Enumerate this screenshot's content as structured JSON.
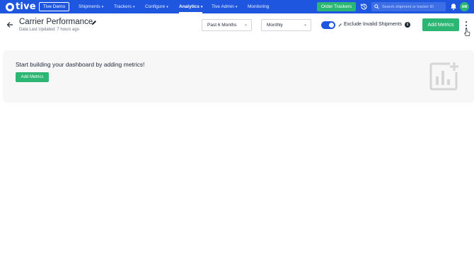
{
  "brand": {
    "name": "tive"
  },
  "topbar": {
    "workspace": "Tive Demo",
    "nav": [
      {
        "label": "Shipments",
        "has_menu": true
      },
      {
        "label": "Trackers",
        "has_menu": true
      },
      {
        "label": "Configure",
        "has_menu": true
      },
      {
        "label": "Analytics",
        "has_menu": true,
        "active": true
      },
      {
        "label": "Tive Admin",
        "has_menu": true
      },
      {
        "label": "Monitoring",
        "has_menu": false
      }
    ],
    "order_button": "Order Trackers",
    "search_placeholder": "Search shipment or tracker ID",
    "avatar_initials": "AM"
  },
  "header": {
    "title": "Carrier Performance",
    "updated": "Data Last Updated: 7 hours ago",
    "range_select": "Past 6 Months",
    "period_select": "Monthly",
    "exclude_toggle_on": true,
    "exclude_label": "Exclude Invalid Shipments",
    "add_button": "Add Metrics"
  },
  "empty_state": {
    "message": "Start building your dashboard by adding metrics!",
    "button": "Add Metrics"
  },
  "colors": {
    "primary": "#1e56e0",
    "accent_green": "#2bb673",
    "card_bg": "#f7f7f7"
  },
  "icons": [
    "history-icon",
    "search-icon",
    "bell-icon",
    "back-arrow-icon",
    "edit-icon",
    "info-icon",
    "kebab-menu-icon",
    "chart-add-icon"
  ]
}
